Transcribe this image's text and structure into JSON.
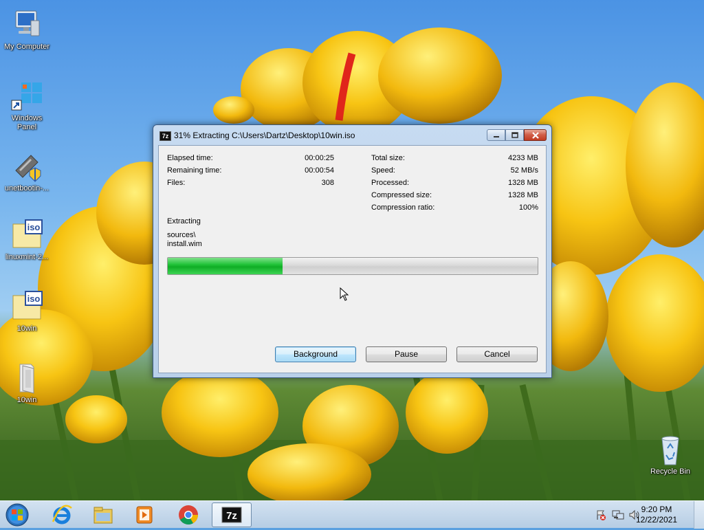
{
  "desktop": {
    "icons": [
      {
        "label": "My Computer",
        "icon": "computer-icon"
      },
      {
        "label": "Windows\nPanel",
        "icon": "windows-panel-shortcut-icon"
      },
      {
        "label": "unetbootin-...",
        "icon": "unetbootin-icon"
      },
      {
        "label": "linuxmint-2...",
        "icon": "iso-file-icon"
      },
      {
        "label": "10win",
        "icon": "iso-file-icon"
      },
      {
        "label": "10win",
        "icon": "folder-icon"
      },
      {
        "label": "Recycle Bin",
        "icon": "recycle-bin-icon"
      }
    ]
  },
  "window": {
    "app_icon_text": "7z",
    "title": "31% Extracting C:\\Users\\Dartz\\Desktop\\10win.iso",
    "left_stats": [
      {
        "label": "Elapsed time:",
        "value": "00:00:25"
      },
      {
        "label": "Remaining time:",
        "value": "00:00:54"
      },
      {
        "label": "Files:",
        "value": "308"
      }
    ],
    "right_stats": [
      {
        "label": "Total size:",
        "value": "4233 MB"
      },
      {
        "label": "Speed:",
        "value": "52 MB/s"
      },
      {
        "label": "Processed:",
        "value": "1328 MB"
      },
      {
        "label": "Compressed size:",
        "value": "1328 MB"
      },
      {
        "label": "Compression ratio:",
        "value": "100%"
      }
    ],
    "status_label": "Extracting",
    "current_path": "sources\\",
    "current_file": "install.wim",
    "progress_percent": 31,
    "buttons": {
      "background": "Background",
      "pause": "Pause",
      "cancel": "Cancel"
    }
  },
  "taskbar": {
    "items": [
      "start-orb-icon",
      "internet-explorer-icon",
      "file-explorer-icon",
      "media-player-icon",
      "chrome-icon",
      "7zip-icon"
    ],
    "active_item": "7zip-icon",
    "time": "9:20 PM",
    "date": "12/22/2021"
  },
  "colors": {
    "progress_green": "#16b52c",
    "titlebar_blue": "#bcd3ec",
    "close_red": "#c7432b"
  }
}
